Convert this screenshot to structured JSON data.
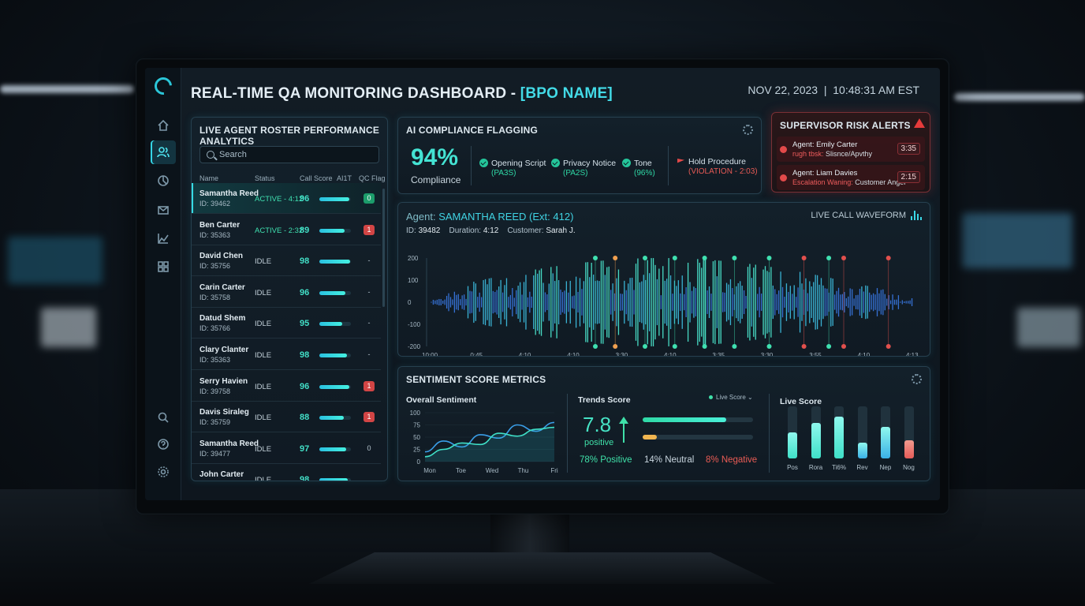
{
  "header": {
    "title_prefix": "REAL-TIME QA MONITORING DASHBOARD - ",
    "title_brand": "[BPO NAME]",
    "date": "NOV 22, 2023",
    "time": "10:48:31 AM EST"
  },
  "sidebar": {
    "items": [
      "home-icon",
      "users-icon",
      "analytics-icon",
      "mail-icon",
      "chart-icon",
      "apps-icon"
    ],
    "bottom_items": [
      "search-icon",
      "help-icon",
      "settings-icon"
    ],
    "active_index": 1
  },
  "roster": {
    "title": "LIVE AGENT ROSTER PERFORMANCE ANALYTICS",
    "search_placeholder": "Search",
    "columns": [
      "Name",
      "Status",
      "Call Score",
      "AI1T",
      "QC Flag"
    ],
    "rows": [
      {
        "name": "Samantha Reed",
        "id": "ID: 39462",
        "status": "ACTIVE - 4:12",
        "score": "96",
        "bar": 0.95,
        "flag": "0",
        "flag_style": "green",
        "active": true
      },
      {
        "name": "Ben Carter",
        "id": "ID: 35363",
        "status": "ACTIVE - 2:32",
        "score": "89",
        "bar": 0.8,
        "flag": "1",
        "flag_style": "red",
        "active": true
      },
      {
        "name": "David Chen",
        "id": "ID: 35756",
        "status": "IDLE",
        "score": "98",
        "bar": 0.98,
        "flag": "-",
        "flag_style": "plain",
        "active": false
      },
      {
        "name": "Carin Carter",
        "id": "ID: 35758",
        "status": "IDLE",
        "score": "96",
        "bar": 0.82,
        "flag": "-",
        "flag_style": "plain",
        "active": false
      },
      {
        "name": "Datud Shem",
        "id": "ID: 35766",
        "status": "IDLE",
        "score": "95",
        "bar": 0.72,
        "flag": "-",
        "flag_style": "plain",
        "active": false
      },
      {
        "name": "Clary Clanter",
        "id": "ID: 35363",
        "status": "IDLE",
        "score": "98",
        "bar": 0.88,
        "flag": "-",
        "flag_style": "plain",
        "active": false
      },
      {
        "name": "Serry Havien",
        "id": "ID: 39758",
        "status": "IDLE",
        "score": "96",
        "bar": 0.95,
        "flag": "1",
        "flag_style": "red",
        "active": false
      },
      {
        "name": "Davis Siraleg",
        "id": "ID: 35759",
        "status": "IDLE",
        "score": "88",
        "bar": 0.78,
        "flag": "1",
        "flag_style": "red",
        "active": false
      },
      {
        "name": "Samantha Reed",
        "id": "ID: 39477",
        "status": "IDLE",
        "score": "97",
        "bar": 0.85,
        "flag": "0",
        "flag_style": "plain",
        "active": false
      },
      {
        "name": "John Carter",
        "id": "",
        "status": "IDLE",
        "score": "98",
        "bar": 0.9,
        "flag": "",
        "flag_style": "plain",
        "active": false
      }
    ]
  },
  "compliance": {
    "title": "AI COMPLIANCE FLAGGING",
    "percent": "94%",
    "percent_label": "Compliance",
    "checks": [
      {
        "label": "Opening Script",
        "result": "(PA3S)"
      },
      {
        "label": "Privacy Notice",
        "result": "(PA2S)"
      },
      {
        "label": "Tone",
        "result": "(96%)"
      }
    ],
    "violation": {
      "label": "Hold Procedure",
      "result": "(VIOLATION - 2:03)"
    }
  },
  "risk": {
    "title": "SUPERVISOR RISK ALERTS",
    "alerts": [
      {
        "agent": "Agent: Emily Carter",
        "tag": "rugh tbsk:",
        "desc": " Slisnce/Apvthy",
        "time": "3:35"
      },
      {
        "agent": "Agent: Liam Davies",
        "tag": "Escalation Waning:",
        "desc": " Customer Anger",
        "time": "2:15"
      }
    ]
  },
  "waveform": {
    "agent_label": "Agent: ",
    "agent_name": "SAMANTHA REED (Ext: 412)",
    "id_label": "ID: ",
    "id_value": "39482",
    "duration_label": "Duration: ",
    "duration_value": "4:12",
    "customer_label": "Customer: ",
    "customer_value": "Sarah J.",
    "panel_label": "LIVE CALL WAVEFORM",
    "y_ticks": [
      "200",
      "100",
      "0",
      "-100",
      "-200"
    ],
    "x_ticks": [
      "10:00",
      "0:45",
      "4:10",
      "4:10",
      "3:30",
      "4:10",
      "3:35",
      "3:30",
      "3:55",
      "4:10",
      "4:13"
    ],
    "colors": {
      "low": "#3a7be8",
      "mid": "#3fc3e6",
      "high": "#4ef0d6",
      "marker_green": "#3fe0b0",
      "marker_orange": "#f0a050",
      "marker_red": "#e2504d"
    }
  },
  "sentiment": {
    "title": "SENTIMENT SCORE METRICS",
    "overall_label": "Overall Sentiment",
    "trends_label": "Trends Score",
    "live_label": "Live Score",
    "live_toggle": "Live Score ⌄",
    "trend_value": "7.8",
    "trend_word": "positive",
    "positive": "78% Positive",
    "neutral": "14% Neutral",
    "negative": "8% Negative",
    "positive_bar": 0.76,
    "neutral_bar": 0.13,
    "colors": {
      "positive": "#3fe0b0",
      "neutral": "#c9d6df",
      "negative": "#ea5c55"
    }
  },
  "chart_data": [
    {
      "type": "area",
      "title": "Overall Sentiment",
      "x": [
        "Mon",
        "Toe",
        "Wed",
        "Thu",
        "Fri"
      ],
      "ylim": [
        0,
        100
      ],
      "y_ticks": [
        "100",
        "75",
        "50",
        "25",
        "0"
      ],
      "series": [
        {
          "values": [
            20,
            42,
            30,
            55,
            48,
            75,
            62,
            80
          ]
        },
        {
          "values": [
            10,
            25,
            38,
            35,
            58,
            52,
            66,
            70
          ]
        }
      ]
    },
    {
      "type": "bar",
      "title": "Live Score",
      "categories": [
        "Pos",
        "Rora",
        "Ti6%",
        "Rev",
        "Nep",
        "Nog"
      ],
      "values": [
        0.5,
        0.68,
        0.8,
        0.3,
        0.6,
        0.35
      ],
      "colors": [
        "#3fe0c8",
        "#3fe0c8",
        "#3fe0c8",
        "#3ab0e6",
        "#3ab0e6",
        "#e55c58"
      ]
    }
  ]
}
